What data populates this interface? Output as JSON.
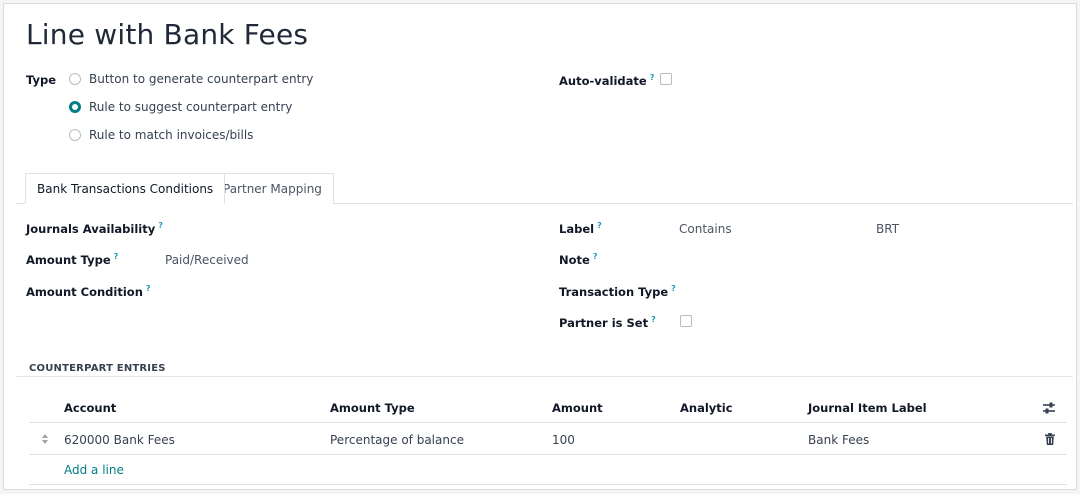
{
  "title": "Line with Bank Fees",
  "type_field": {
    "label": "Type",
    "options": [
      {
        "label": "Button to generate counterpart entry",
        "selected": false
      },
      {
        "label": "Rule to suggest counterpart entry",
        "selected": true
      },
      {
        "label": "Rule to match invoices/bills",
        "selected": false
      }
    ]
  },
  "auto_validate": {
    "label": "Auto-validate",
    "help": "?",
    "checked": false
  },
  "tabs": [
    {
      "label": "Bank Transactions Conditions",
      "active": true
    },
    {
      "label": "Partner Mapping",
      "active": false
    }
  ],
  "conditions": {
    "journals_availability": {
      "label": "Journals Availability",
      "help": "?",
      "value": ""
    },
    "amount_type": {
      "label": "Amount Type",
      "help": "?",
      "value": "Paid/Received"
    },
    "amount_condition": {
      "label": "Amount Condition",
      "help": "?",
      "value": ""
    },
    "label": {
      "label": "Label",
      "help": "?",
      "operator": "Contains",
      "value": "BRT"
    },
    "note": {
      "label": "Note",
      "help": "?",
      "value": ""
    },
    "transaction_type": {
      "label": "Transaction Type",
      "help": "?",
      "value": ""
    },
    "partner_is_set": {
      "label": "Partner is Set",
      "help": "?",
      "checked": false
    }
  },
  "counterpart": {
    "section_title": "COUNTERPART ENTRIES",
    "columns": [
      "Account",
      "Amount Type",
      "Amount",
      "Analytic",
      "Journal Item Label"
    ],
    "rows": [
      {
        "account": "620000 Bank Fees",
        "amount_type": "Percentage of balance",
        "amount": "100",
        "analytic": "",
        "label": "Bank Fees"
      }
    ],
    "add_line": "Add a line"
  },
  "colors": {
    "accent": "#017e84",
    "help": "#1f9bb0"
  },
  "icons": [
    "sliders-icon",
    "trash-icon",
    "drag-handle-icon",
    "radio-icon",
    "checkbox-icon"
  ]
}
